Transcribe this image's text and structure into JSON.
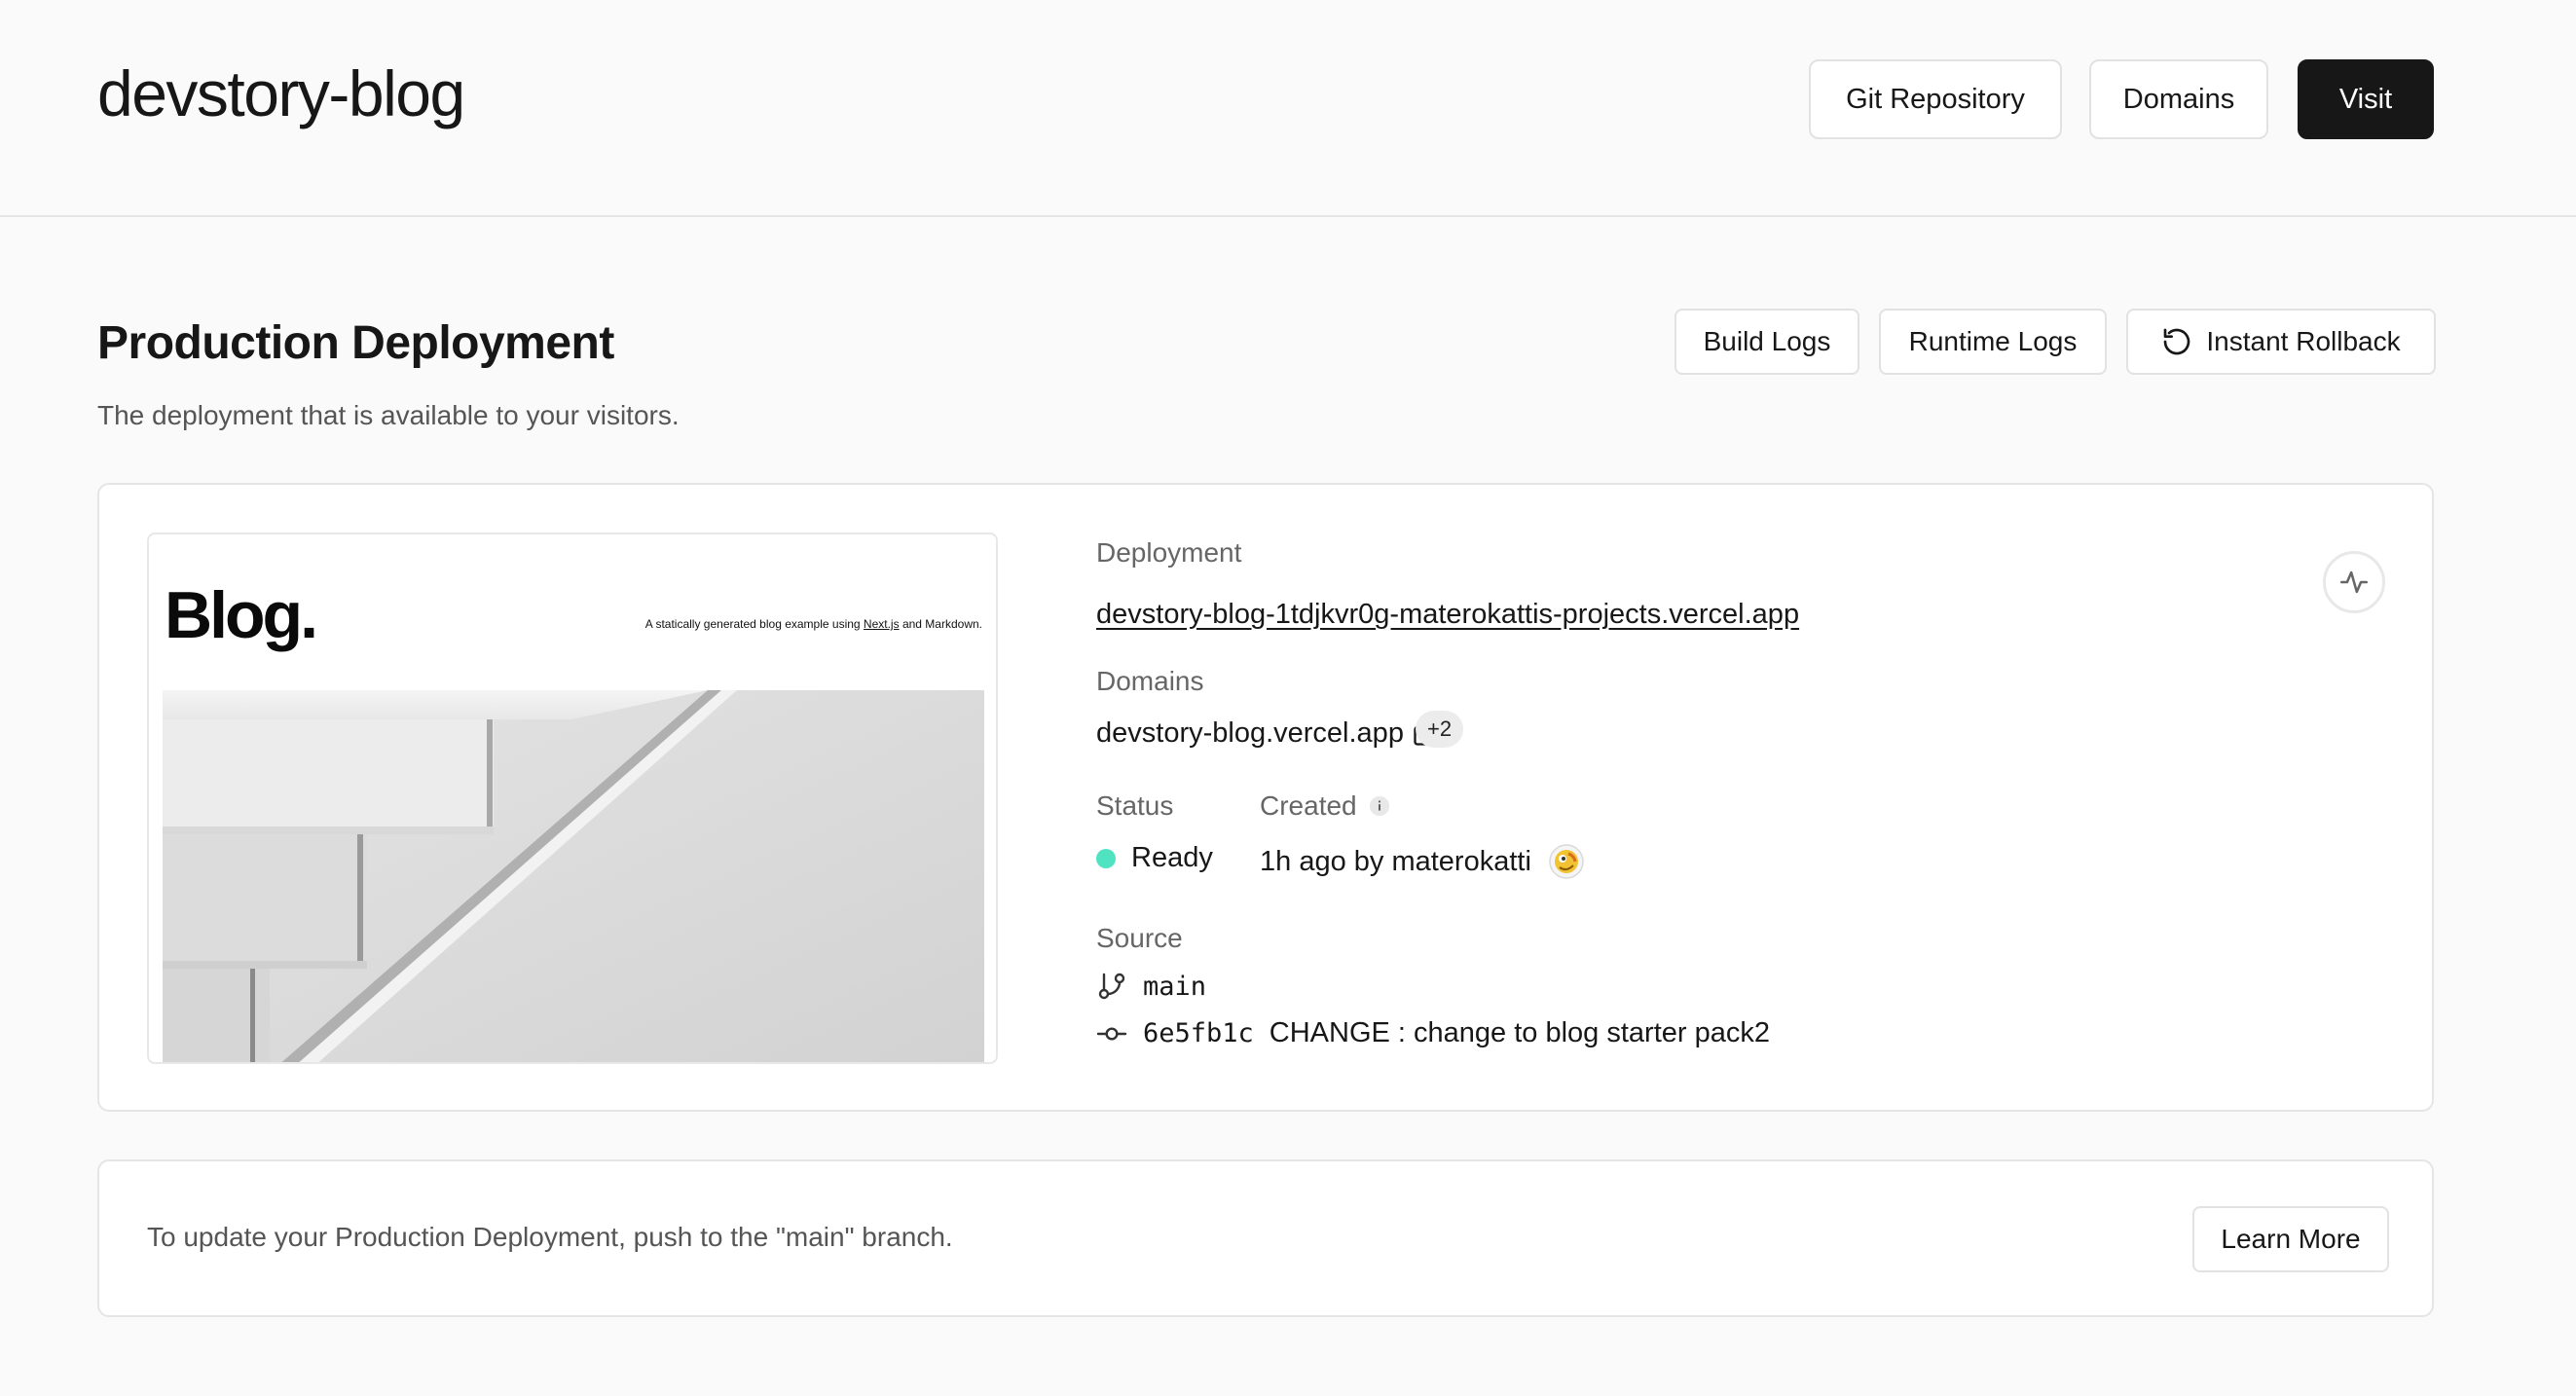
{
  "header": {
    "title": "devstory-blog",
    "git_repository_label": "Git Repository",
    "domains_label": "Domains",
    "visit_label": "Visit"
  },
  "production": {
    "title": "Production Deployment",
    "subtitle": "The deployment that is available to your visitors.",
    "build_logs_label": "Build Logs",
    "runtime_logs_label": "Runtime Logs",
    "instant_rollback_label": "Instant Rollback"
  },
  "preview": {
    "logo": "Blog.",
    "tagline_before": "A statically generated blog example using ",
    "tagline_link": "Next.js",
    "tagline_after": " and Markdown."
  },
  "deployment": {
    "deployment_label": "Deployment",
    "deployment_url": "devstory-blog-1tdjkvr0g-materokattis-projects.vercel.app",
    "domains_label": "Domains",
    "domain": "devstory-blog.vercel.app",
    "extra_domains": "+2",
    "status_label": "Status",
    "status_value": "Ready",
    "status_color": "#50e3c2",
    "created_label": "Created",
    "created_value": "1h ago by materokatti",
    "source_label": "Source",
    "branch": "main",
    "commit_hash": "6e5fb1c",
    "commit_message": "CHANGE : change to blog starter pack2"
  },
  "footer": {
    "message": "To update your Production Deployment, push to the \"main\" branch.",
    "learn_more_label": "Learn More"
  },
  "icons": {
    "rollback": "rollback-icon",
    "activity": "activity-icon",
    "external_link": "external-link-icon",
    "info": "info-icon",
    "branch": "git-branch-icon",
    "commit": "git-commit-icon"
  },
  "colors": {
    "accent_dark": "#171717",
    "ready": "#50e3c2"
  }
}
